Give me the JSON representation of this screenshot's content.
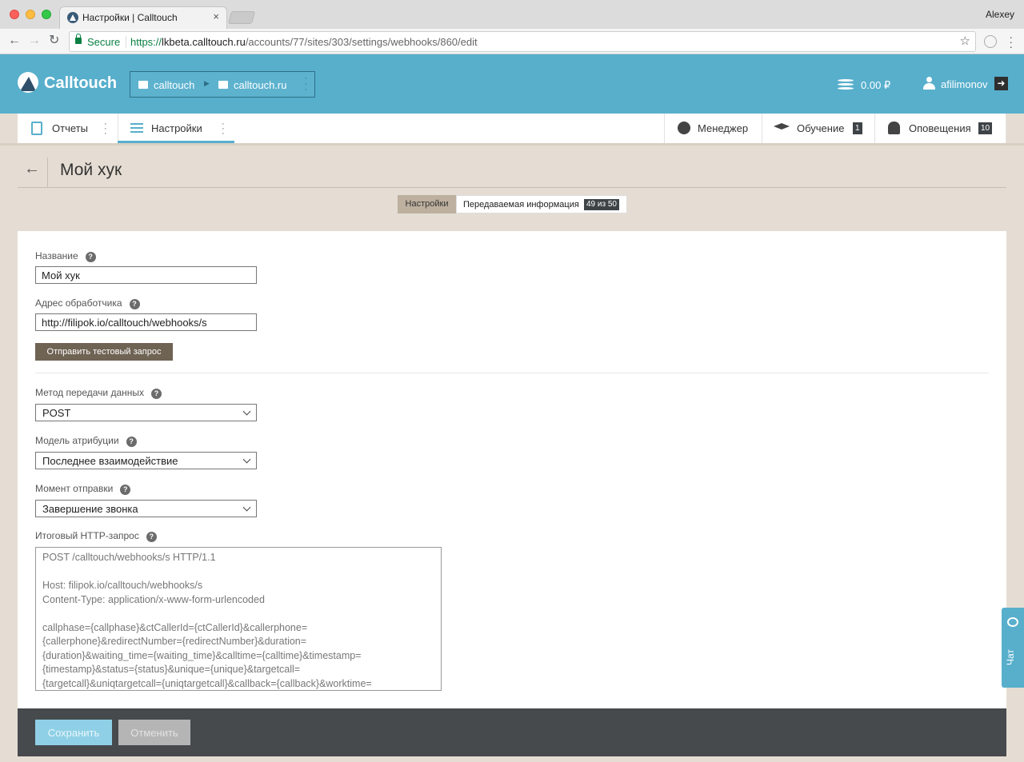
{
  "browser": {
    "tab_title": "Настройки | Calltouch",
    "tab_close": "×",
    "user": "Alexey",
    "secure_label": "Secure",
    "url_proto": "https://",
    "url_host": "lkbeta.calltouch.ru",
    "url_path": "/accounts/77/sites/303/settings/webhooks/860/edit"
  },
  "header": {
    "logo": "Calltouch",
    "account": "calltouch",
    "site": "calltouch.ru",
    "balance": "0.00 ₽",
    "username": "afilimonov",
    "accent_color": "#57afcc"
  },
  "subnav": {
    "reports": "Отчеты",
    "settings": "Настройки",
    "manager": "Менеджер",
    "training": "Обучение",
    "training_count": "1",
    "notifications": "Оповещения",
    "notifications_count": "10"
  },
  "page": {
    "back": "←",
    "title": "Мой хук",
    "tab_settings": "Настройки",
    "tab_info": "Передаваемая информация",
    "tab_info_badge": "49 из 50"
  },
  "form": {
    "name_label": "Название",
    "name_value": "Мой хук",
    "url_label": "Адрес обработчика",
    "url_value": "http://filipok.io/calltouch/webhooks/s",
    "test_button": "Отправить тестовый запрос",
    "method_label": "Метод передачи данных",
    "method_value": "POST",
    "attribution_label": "Модель атрибуции",
    "attribution_value": "Последнее взаимодействие",
    "moment_label": "Момент отправки",
    "moment_value": "Завершение звонка",
    "http_label": "Итоговый HTTP-запрос",
    "help": "?",
    "http_lines": [
      "POST /calltouch/webhooks/s HTTP/1.1",
      "",
      "Host: filipok.io/calltouch/webhooks/s",
      "Content-Type: application/x-www-form-urlencoded",
      "",
      "callphase={callphase}&ctCallerId={ctCallerId}&callerphone=",
      "{callerphone}&redirectNumber={redirectNumber}&duration=",
      "{duration}&waiting_time={waiting_time}&calltime={calltime}&timestamp=",
      "{timestamp}&status={status}&unique={unique}&targetcall=",
      "{targetcall}&uniqtargetcall={uniqtargetcall}&callback={callback}&worktime="
    ]
  },
  "footer": {
    "save": "Сохранить",
    "cancel": "Отменить"
  },
  "chat": {
    "label": "Чат"
  }
}
